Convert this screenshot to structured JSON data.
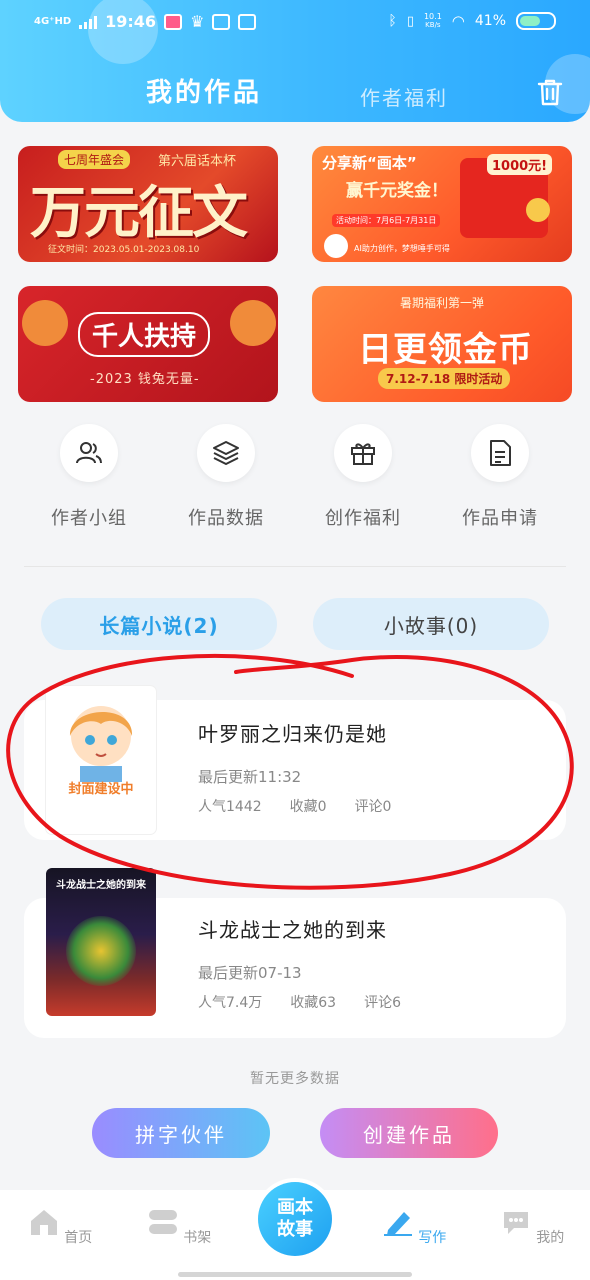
{
  "status_bar": {
    "network": "4G⁺HD",
    "time": "19:46",
    "speed_value": "10.1",
    "speed_unit": "KB/s",
    "battery": "41%"
  },
  "header": {
    "tab_active": "我的作品",
    "tab_inactive": "作者福利",
    "trash_icon": "trash-icon"
  },
  "banners": [
    {
      "title": "万元征文",
      "sub1": "七周年盛会",
      "sub2": "第六届话本杯",
      "date": "征文时间：2023.05.01-2023.08.10"
    },
    {
      "title": "分享新“画本”",
      "sub": "赢千元奖金！",
      "prize": "1000元!",
      "date": "活动时间：7月6日-7月31日",
      "footer": "AI助力创作，梦想唾手可得"
    },
    {
      "title": "千人扶持",
      "sub": "-2023 钱兔无量-"
    },
    {
      "kicker": "暑期福利第一弹",
      "title": "日更领金币",
      "date": "7.12-7.18 限时活动"
    }
  ],
  "quick_actions": [
    {
      "label": "作者小组",
      "icon": "users-icon"
    },
    {
      "label": "作品数据",
      "icon": "layers-icon"
    },
    {
      "label": "创作福利",
      "icon": "gift-icon"
    },
    {
      "label": "作品申请",
      "icon": "document-icon"
    }
  ],
  "segments": {
    "long": "长篇小说(2)",
    "short": "小故事(0)"
  },
  "works": [
    {
      "cover_text": "封面建设中",
      "title": "叶罗丽之归来仍是她",
      "updated": "最后更新11:32",
      "popularity": "人气1442",
      "favorites": "收藏0",
      "comments": "评论0"
    },
    {
      "cover_text": "斗龙战士之她的到来",
      "title": "斗龙战士之她的到来",
      "updated": "最后更新07-13",
      "popularity": "人气7.4万",
      "favorites": "收藏63",
      "comments": "评论6"
    }
  ],
  "no_more": "暂无更多数据",
  "buttons": {
    "partner": "拼字伙伴",
    "create": "创建作品"
  },
  "nav": {
    "home": "首页",
    "shelf": "书架",
    "center_line1": "画本",
    "center_line2": "故事",
    "write": "写作",
    "mine": "我的"
  },
  "colors": {
    "accent": "#3aa8ef",
    "header_start": "#5ed2ff",
    "header_end": "#2aa8ff",
    "annotation": "#e8151b"
  }
}
